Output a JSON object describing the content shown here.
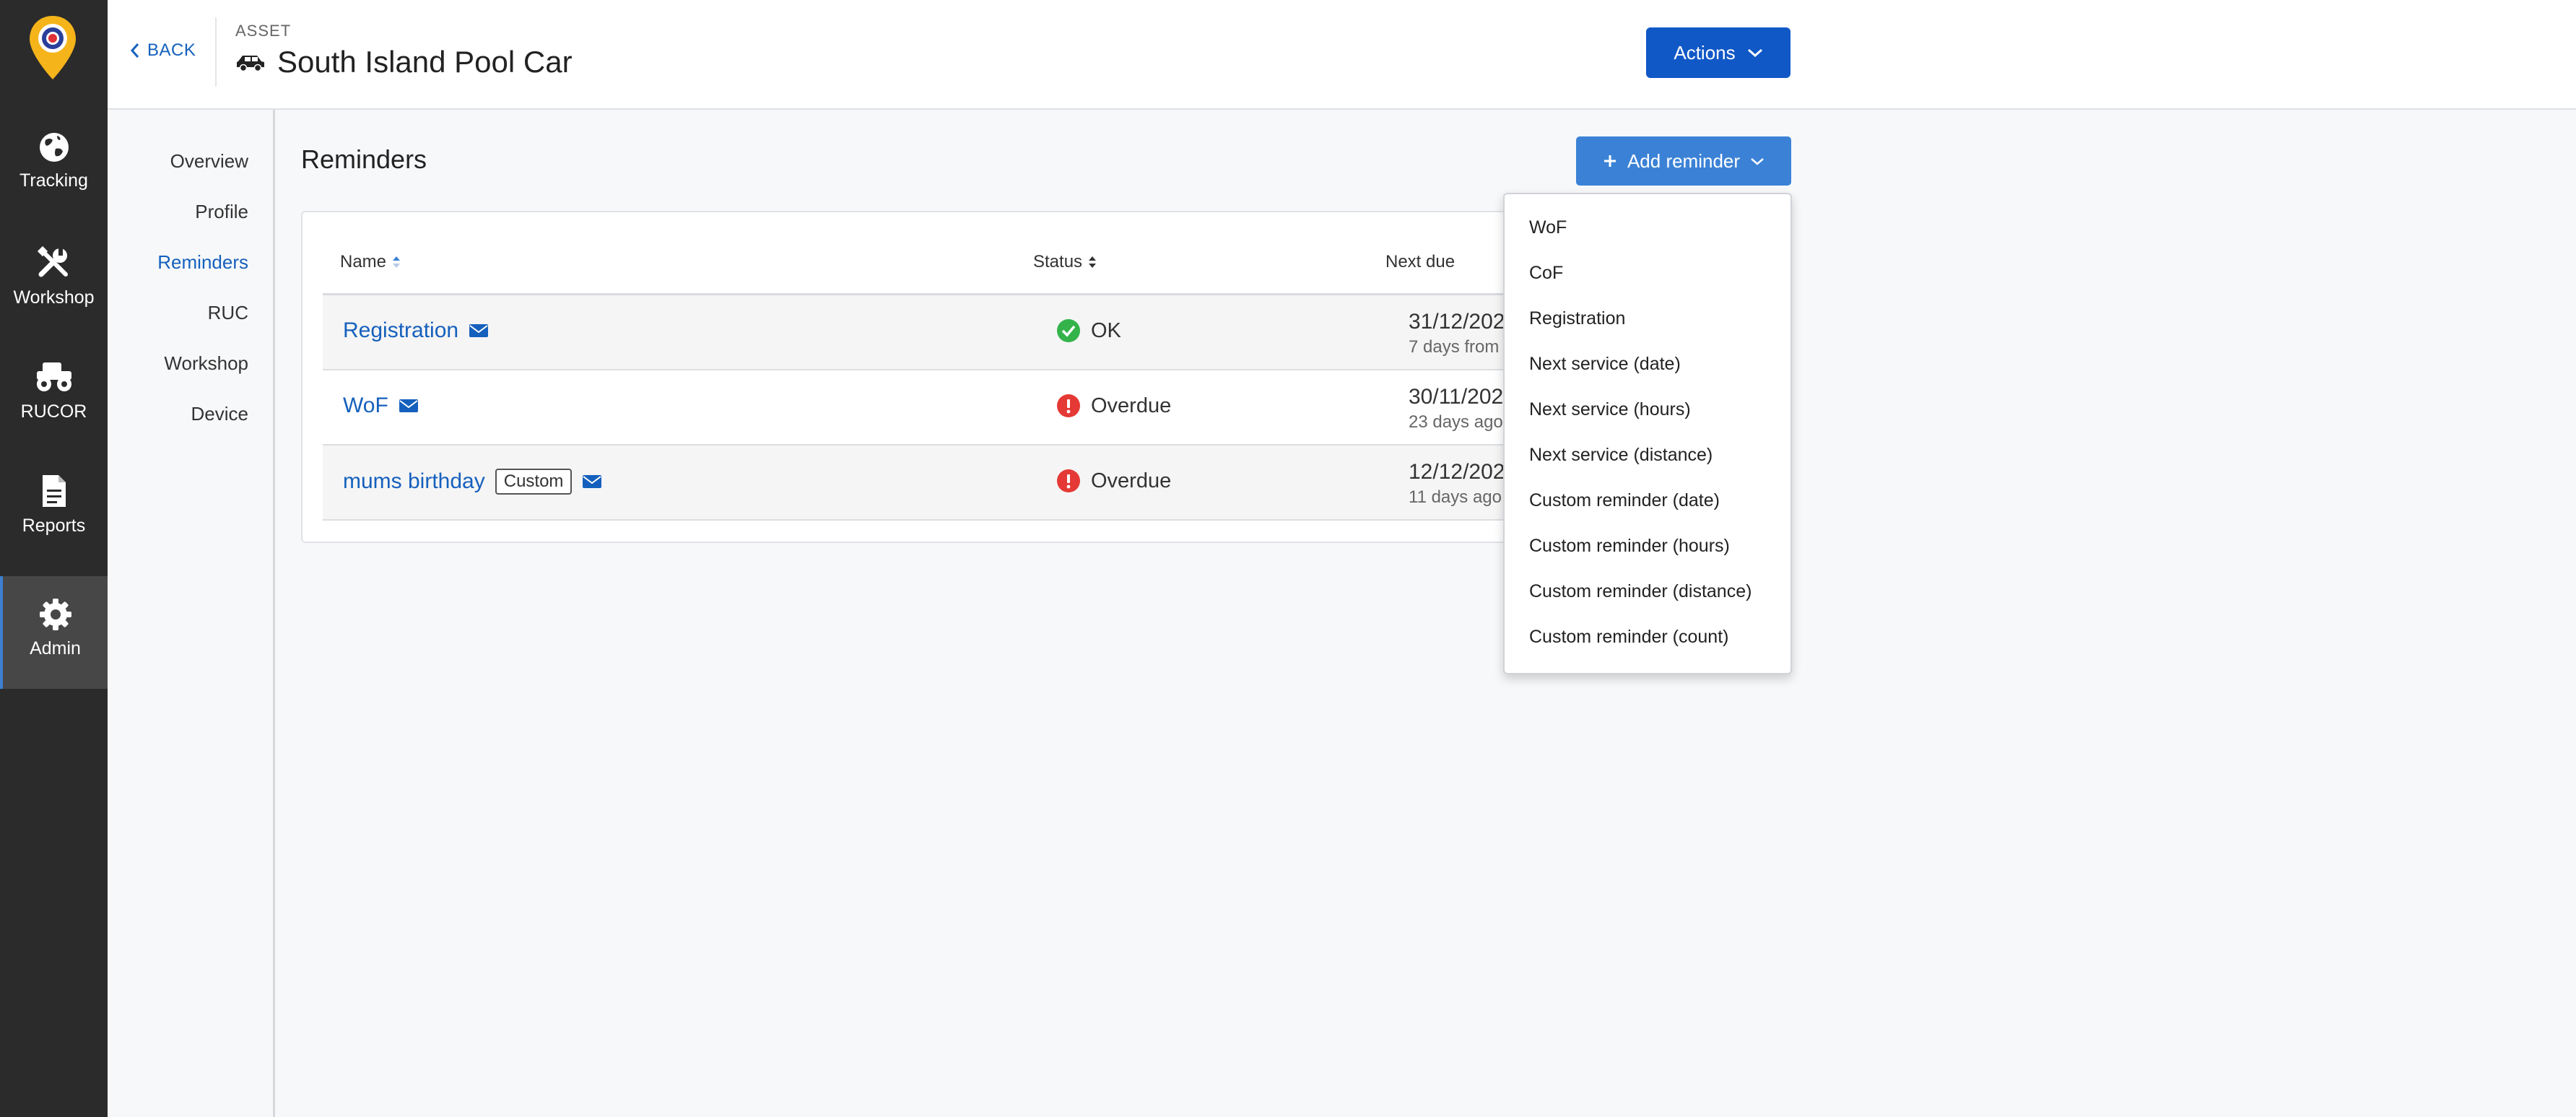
{
  "colors": {
    "sidebar_bg": "#2b2b2b",
    "active_nav_bg": "#474747",
    "primary_button": "#1158c7",
    "add_button": "#3b82d6",
    "link": "#1560bd",
    "ok_green": "#34b34a",
    "overdue_red": "#e53935",
    "logo_yellow": "#f4b41a"
  },
  "sidebar": {
    "logo_icon": "location-pin-logo",
    "items": [
      {
        "label": "Tracking",
        "icon": "globe-icon",
        "active": false
      },
      {
        "label": "Workshop",
        "icon": "wrench-screwdriver-icon",
        "active": false
      },
      {
        "label": "RUCOR",
        "icon": "monster-truck-icon",
        "active": false
      },
      {
        "label": "Reports",
        "icon": "document-icon",
        "active": false
      },
      {
        "label": "Admin",
        "icon": "gear-icon",
        "active": true
      }
    ]
  },
  "header": {
    "back_label": "BACK",
    "asset_label": "ASSET",
    "asset_icon": "car-icon",
    "title": "South Island Pool Car",
    "actions_label": "Actions"
  },
  "subnav": {
    "items": [
      {
        "label": "Overview",
        "active": false
      },
      {
        "label": "Profile",
        "active": false
      },
      {
        "label": "Reminders",
        "active": true
      },
      {
        "label": "RUC",
        "active": false
      },
      {
        "label": "Workshop",
        "active": false
      },
      {
        "label": "Device",
        "active": false
      }
    ]
  },
  "main": {
    "section_title": "Reminders",
    "add_reminder_label": "Add reminder",
    "table": {
      "columns": [
        "Name",
        "Status",
        "Next due"
      ],
      "rows": [
        {
          "name": "Registration",
          "badge": "",
          "status": "OK",
          "status_type": "ok",
          "due_date": "31/12/2024",
          "due_relative": "7 days from now"
        },
        {
          "name": "WoF",
          "badge": "",
          "status": "Overdue",
          "status_type": "overdue",
          "due_date": "30/11/2024",
          "due_relative": "23 days ago"
        },
        {
          "name": "mums birthday",
          "badge": "Custom",
          "status": "Overdue",
          "status_type": "overdue",
          "due_date": "12/12/2024",
          "due_relative": "11 days ago"
        }
      ]
    }
  },
  "dropdown": {
    "items": [
      "WoF",
      "CoF",
      "Registration",
      "Next service (date)",
      "Next service (hours)",
      "Next service (distance)",
      "Custom reminder (date)",
      "Custom reminder (hours)",
      "Custom reminder (distance)",
      "Custom reminder (count)"
    ]
  }
}
